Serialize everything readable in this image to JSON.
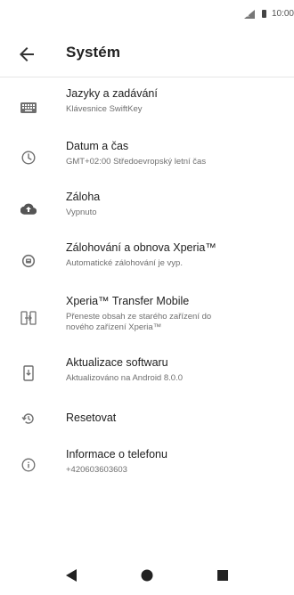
{
  "status_bar": {
    "time": "10:00"
  },
  "app_bar": {
    "back_icon": "arrow-left-icon",
    "title": "Systém"
  },
  "items": [
    {
      "title": "Jazyky a zadávání",
      "subtitle": "Klávesnice SwiftKey",
      "icon": "keyboard-icon"
    },
    {
      "title": "Datum a čas",
      "subtitle": "GMT+02:00 Středoevropský letní čas",
      "icon": "clock-icon"
    },
    {
      "title": "Záloha",
      "subtitle": "Vypnuto",
      "icon": "cloud-upload-icon"
    },
    {
      "title": "Zálohování a obnova Xperia™",
      "subtitle": "Automatické zálohování je vyp.",
      "icon": "backup-restore-icon"
    },
    {
      "title": "Xperia™ Transfer Mobile",
      "subtitle_line1": "Přeneste obsah ze starého zařízení do",
      "subtitle_line2": "nového zařízení Xperia™",
      "icon": "transfer-icon"
    },
    {
      "title": "Aktualizace softwaru",
      "subtitle": "Aktualizováno na Android 8.0.0",
      "icon": "system-update-icon"
    },
    {
      "title": "Resetovat",
      "icon": "history-icon"
    },
    {
      "title": "Informace o telefonu",
      "subtitle": "+420603603603",
      "icon": "info-icon"
    }
  ],
  "nav_bar": {
    "back": "nav-back-icon",
    "home": "nav-home-icon",
    "recents": "nav-recents-icon"
  }
}
